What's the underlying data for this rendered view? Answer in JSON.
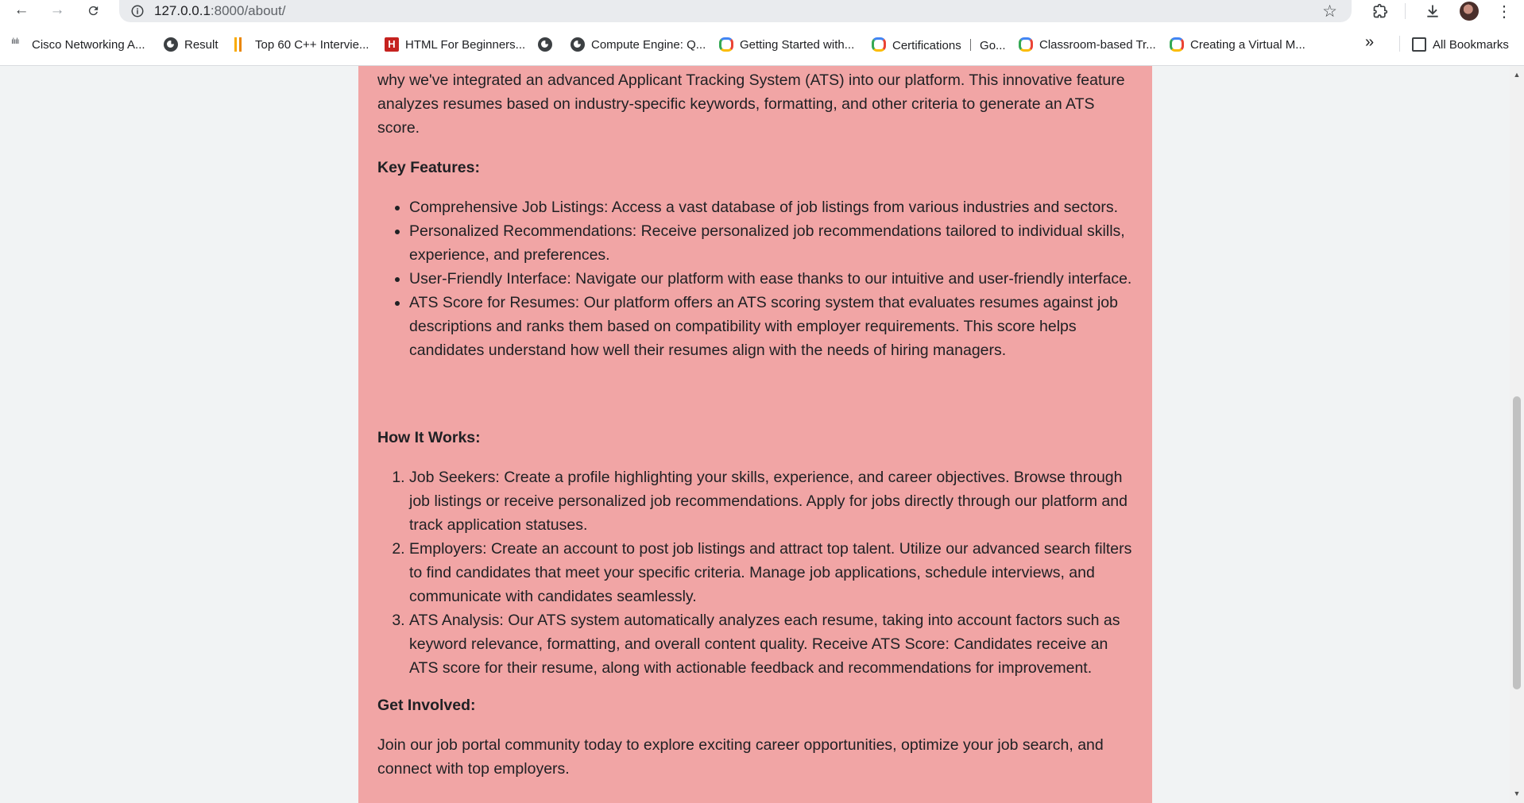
{
  "browser": {
    "url_host": "127.0.0.1",
    "url_path": ":8000/about/",
    "bookmarks": [
      "Cisco Networking A...",
      "Result",
      "Top 60 C++ Intervie...",
      "HTML For Beginners...",
      "",
      "Compute Engine: Q...",
      "Getting Started with...",
      "Certifications ｜ Go...",
      "Classroom-based Tr...",
      "Creating a Virtual M..."
    ],
    "overflow_label": "»",
    "all_bookmarks": "All Bookmarks"
  },
  "about": {
    "intro_tail": "why we've integrated an advanced Applicant Tracking System (ATS) into our platform. This innovative feature analyzes resumes based on industry-specific keywords, formatting, and other criteria to generate an ATS score.",
    "key_features_heading": "Key Features:",
    "key_features": [
      "Comprehensive Job Listings: Access a vast database of job listings from various industries and sectors.",
      "Personalized Recommendations: Receive personalized job recommendations tailored to individual skills, experience, and preferences.",
      "User-Friendly Interface: Navigate our platform with ease thanks to our intuitive and user-friendly interface.",
      "ATS Score for Resumes: Our platform offers an ATS scoring system that evaluates resumes against job descriptions and ranks them based on compatibility with employer requirements. This score helps candidates understand how well their resumes align with the needs of hiring managers."
    ],
    "how_heading": "How It Works:",
    "how_steps": [
      "Job Seekers: Create a profile highlighting your skills, experience, and career objectives. Browse through job listings or receive personalized job recommendations. Apply for jobs directly through our platform and track application statuses.",
      "Employers: Create an account to post job listings and attract top talent. Utilize our advanced search filters to find candidates that meet your specific criteria. Manage job applications, schedule interviews, and communicate with candidates seamlessly.",
      "ATS Analysis: Our ATS system automatically analyzes each resume, taking into account factors such as keyword relevance, formatting, and overall content quality. Receive ATS Score: Candidates receive an ATS score for their resume, along with actionable feedback and recommendations for improvement."
    ],
    "involved_heading": "Get Involved:",
    "closing": "Join our job portal community today to explore exciting career opportunities, optimize your job search, and connect with top employers."
  },
  "colors": {
    "card_background": "#f1a5a5",
    "page_background": "#f1f3f4"
  }
}
